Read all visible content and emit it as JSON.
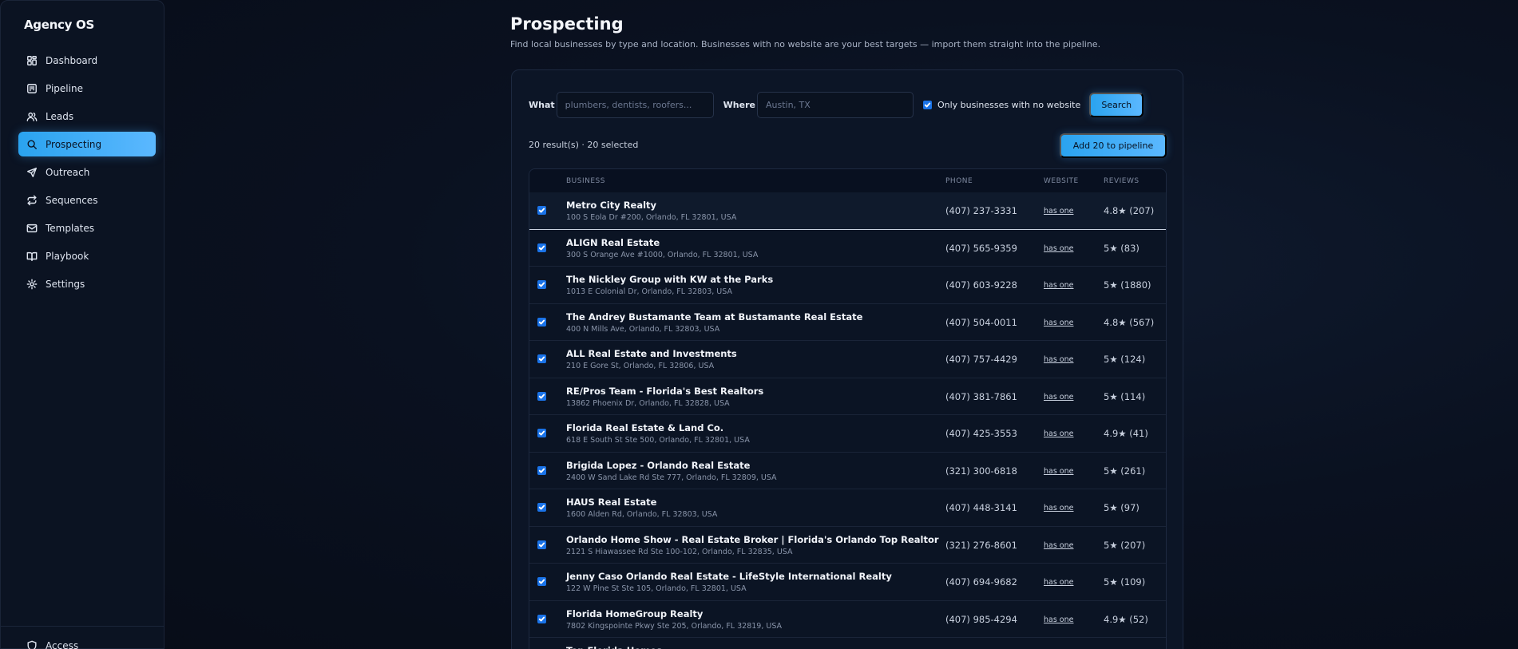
{
  "sidebar": {
    "brand": "Agency OS",
    "items": [
      {
        "label": "Dashboard",
        "icon": "dashboard-icon"
      },
      {
        "label": "Pipeline",
        "icon": "pipeline-icon"
      },
      {
        "label": "Leads",
        "icon": "users-icon"
      },
      {
        "label": "Prospecting",
        "icon": "search-icon",
        "active": true
      },
      {
        "label": "Outreach",
        "icon": "send-icon"
      },
      {
        "label": "Sequences",
        "icon": "repeat-icon"
      },
      {
        "label": "Templates",
        "icon": "mail-icon"
      },
      {
        "label": "Playbook",
        "icon": "book-icon"
      },
      {
        "label": "Settings",
        "icon": "gear-icon"
      }
    ],
    "bottom_label": "Access"
  },
  "header": {
    "title": "Prospecting",
    "subtitle": "Find local businesses by type and location. Businesses with no website are your best targets — import them straight into the pipeline."
  },
  "search": {
    "what_label": "What",
    "what_placeholder": "plumbers, dentists, roofers...",
    "where_label": "Where",
    "where_placeholder": "Austin, TX",
    "no_website_label": "Only businesses with no website",
    "search_button": "Search"
  },
  "results": {
    "summary": "20 result(s) · 20 selected",
    "add_button": "Add 20 to pipeline"
  },
  "table": {
    "headers": {
      "business": "BUSINESS",
      "phone": "PHONE",
      "website": "WEBSITE",
      "reviews": "REVIEWS"
    },
    "rows": [
      {
        "name": "Metro City Realty",
        "address": "100 S Eola Dr #200, Orlando, FL 32801, USA",
        "phone": "(407) 237-3331",
        "website": "has one",
        "reviews": "4.8★ (207)"
      },
      {
        "name": "ALIGN Real Estate",
        "address": "300 S Orange Ave #1000, Orlando, FL 32801, USA",
        "phone": "(407) 565-9359",
        "website": "has one",
        "reviews": "5★ (83)"
      },
      {
        "name": "The Nickley Group with KW at the Parks",
        "address": "1013 E Colonial Dr, Orlando, FL 32803, USA",
        "phone": "(407) 603-9228",
        "website": "has one",
        "reviews": "5★ (1880)"
      },
      {
        "name": "The Andrey Bustamante Team at Bustamante Real Estate",
        "address": "400 N Mills Ave, Orlando, FL 32803, USA",
        "phone": "(407) 504-0011",
        "website": "has one",
        "reviews": "4.8★ (567)"
      },
      {
        "name": "ALL Real Estate and Investments",
        "address": "210 E Gore St, Orlando, FL 32806, USA",
        "phone": "(407) 757-4429",
        "website": "has one",
        "reviews": "5★ (124)"
      },
      {
        "name": "RE/Pros Team - Florida's Best Realtors",
        "address": "13862 Phoenix Dr, Orlando, FL 32828, USA",
        "phone": "(407) 381-7861",
        "website": "has one",
        "reviews": "5★ (114)"
      },
      {
        "name": "Florida Real Estate & Land Co.",
        "address": "618 E South St Ste 500, Orlando, FL 32801, USA",
        "phone": "(407) 425-3553",
        "website": "has one",
        "reviews": "4.9★ (41)"
      },
      {
        "name": "Brigida Lopez - Orlando Real Estate",
        "address": "2400 W Sand Lake Rd Ste 777, Orlando, FL 32809, USA",
        "phone": "(321) 300-6818",
        "website": "has one",
        "reviews": "5★ (261)"
      },
      {
        "name": "HAUS Real Estate",
        "address": "1600 Alden Rd, Orlando, FL 32803, USA",
        "phone": "(407) 448-3141",
        "website": "has one",
        "reviews": "5★ (97)"
      },
      {
        "name": "Orlando Home Show - Real Estate Broker | Florida's Orlando Top Realtor",
        "address": "2121 S Hiawassee Rd Ste 100-102, Orlando, FL 32835, USA",
        "phone": "(321) 276-8601",
        "website": "has one",
        "reviews": "5★ (207)"
      },
      {
        "name": "Jenny Caso Orlando Real Estate - LifeStyle International Realty",
        "address": "122 W Pine St Ste 105, Orlando, FL 32801, USA",
        "phone": "(407) 694-9682",
        "website": "has one",
        "reviews": "5★ (109)"
      },
      {
        "name": "Florida HomeGroup Realty",
        "address": "7802 Kingspointe Pkwy Ste 205, Orlando, FL 32819, USA",
        "phone": "(407) 985-4294",
        "website": "has one",
        "reviews": "4.9★ (52)"
      },
      {
        "name": "Top Florida Homes",
        "address": "",
        "phone": "",
        "website": "",
        "reviews": ""
      }
    ]
  },
  "colors": {
    "accent": "#3aaaf5",
    "checkbox": "#1a73e8",
    "background": "#0a1120"
  }
}
